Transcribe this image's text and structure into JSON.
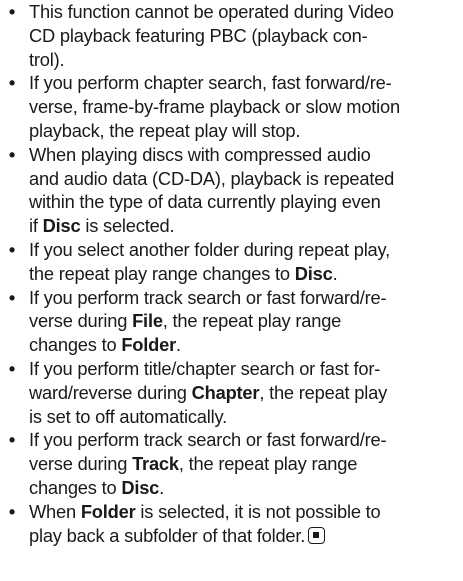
{
  "bullet_char": "•",
  "items": [
    {
      "lines": [
        [
          {
            "t": "This function cannot be operated during Video"
          }
        ],
        [
          {
            "t": "CD playback featuring PBC (playback con-"
          }
        ],
        [
          {
            "t": "trol)."
          }
        ]
      ]
    },
    {
      "lines": [
        [
          {
            "t": "If you perform chapter search, fast forward/re-"
          }
        ],
        [
          {
            "t": "verse, frame-by-frame playback or slow motion"
          }
        ],
        [
          {
            "t": "playback, the repeat play will stop."
          }
        ]
      ]
    },
    {
      "lines": [
        [
          {
            "t": "When playing discs with compressed audio"
          }
        ],
        [
          {
            "t": "and audio data (CD-DA), playback is repeated"
          }
        ],
        [
          {
            "t": "within the type of data currently playing even"
          }
        ],
        [
          {
            "t": "if "
          },
          {
            "t": "Disc",
            "b": true
          },
          {
            "t": " is selected."
          }
        ]
      ]
    },
    {
      "lines": [
        [
          {
            "t": "If you select another folder during repeat play,"
          }
        ],
        [
          {
            "t": "the repeat play range changes to "
          },
          {
            "t": "Disc",
            "b": true
          },
          {
            "t": "."
          }
        ]
      ]
    },
    {
      "lines": [
        [
          {
            "t": "If you perform track search or fast forward/re-"
          }
        ],
        [
          {
            "t": "verse during "
          },
          {
            "t": "File",
            "b": true
          },
          {
            "t": ", the repeat play range"
          }
        ],
        [
          {
            "t": "changes to "
          },
          {
            "t": "Folder",
            "b": true
          },
          {
            "t": "."
          }
        ]
      ]
    },
    {
      "lines": [
        [
          {
            "t": "If you perform title/chapter search or fast for-"
          }
        ],
        [
          {
            "t": "ward/reverse during "
          },
          {
            "t": "Chapter",
            "b": true
          },
          {
            "t": ", the repeat play"
          }
        ],
        [
          {
            "t": "is set to off automatically."
          }
        ]
      ]
    },
    {
      "lines": [
        [
          {
            "t": "If you perform track search or fast forward/re-"
          }
        ],
        [
          {
            "t": "verse during "
          },
          {
            "t": "Track",
            "b": true
          },
          {
            "t": ", the repeat play range"
          }
        ],
        [
          {
            "t": "changes to "
          },
          {
            "t": "Disc",
            "b": true
          },
          {
            "t": "."
          }
        ]
      ]
    },
    {
      "lines": [
        [
          {
            "t": "When "
          },
          {
            "t": "Folder",
            "b": true
          },
          {
            "t": " is selected, it is not possible to"
          }
        ],
        [
          {
            "t": "play back a subfolder of that folder."
          }
        ]
      ],
      "end_mark": "end-of-section-icon"
    }
  ]
}
